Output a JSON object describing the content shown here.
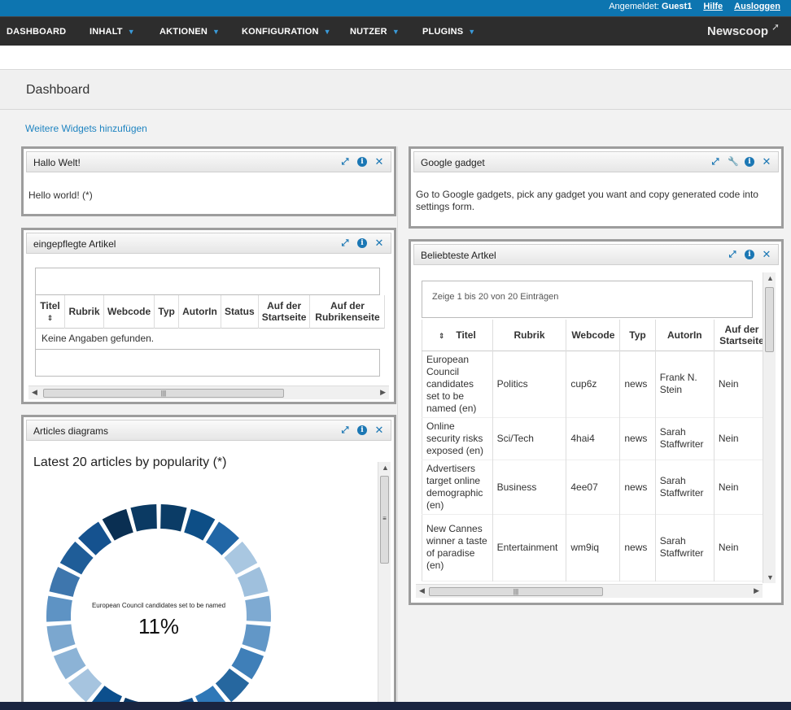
{
  "topbar": {
    "logged_in_label": "Angemeldet:",
    "user": "Guest1",
    "help": "Hilfe",
    "logout": "Ausloggen"
  },
  "nav": {
    "items": [
      "DASHBOARD",
      "INHALT",
      "AKTIONEN",
      "KONFIGURATION",
      "NUTZER",
      "PLUGINS"
    ],
    "logo": "Newscoop"
  },
  "page": {
    "title": "Dashboard",
    "add_widgets": "Weitere Widgets hinzufügen"
  },
  "hello_widget": {
    "title": "Hallo Welt!",
    "body": "Hello world! (*)"
  },
  "google_widget": {
    "title": "Google gadget",
    "body": "Go to Google gadgets, pick any gadget you want and copy generated code into settings form."
  },
  "maintained_widget": {
    "title": "eingepflegte Artikel",
    "headers": [
      "Titel",
      "Rubrik",
      "Webcode",
      "Typ",
      "AutorIn",
      "Status",
      "Auf der Startseite",
      "Auf der Rubrikenseite"
    ],
    "empty": "Keine Angaben gefunden."
  },
  "popular_widget": {
    "title": "Beliebteste Artkel",
    "info": "Zeige 1 bis 20 von 20 Einträgen",
    "headers": [
      "Titel",
      "Rubrik",
      "Webcode",
      "Typ",
      "AutorIn",
      "Auf der Startseite"
    ],
    "rows": [
      {
        "title": "European Council candidates set to be named (en)",
        "rubrik": "Politics",
        "webcode": "cup6z",
        "typ": "news",
        "autor": "Frank N. Stein",
        "start": "Nein"
      },
      {
        "title": "Online security risks exposed (en)",
        "rubrik": "Sci/Tech",
        "webcode": "4hai4",
        "typ": "news",
        "autor": "Sarah Staffwriter",
        "start": "Nein"
      },
      {
        "title": "Advertisers target online demographic (en)",
        "rubrik": "Business",
        "webcode": "4ee07",
        "typ": "news",
        "autor": "Sarah Staffwriter",
        "start": "Nein"
      },
      {
        "title": "New Cannes winner a taste of paradise (en)",
        "rubrik": "Entertainment",
        "webcode": "wm9iq",
        "typ": "news",
        "autor": "Sarah Staffwriter",
        "start": "Nein"
      }
    ]
  },
  "diagram_widget": {
    "title": "Articles diagrams",
    "heading": "Latest 20 articles by popularity (*)",
    "center_label": "European Council candidates set to be named",
    "center_value": "11%"
  },
  "chart_data": {
    "type": "pie",
    "title": "Latest 20 articles by popularity (*)",
    "highlighted": {
      "label": "European Council candidates set to be named",
      "value": 11
    },
    "slice_colors": [
      "#0b3c66",
      "#0d4e86",
      "#2166a6",
      "#a9c7e1",
      "#9fc0dd",
      "#7eaad2",
      "#6297c7",
      "#3f7fb8",
      "#26679f",
      "#2f78b8",
      "#134f8a",
      "#0e4478",
      "#0a3a69",
      "#0c4f8d",
      "#a6c4df",
      "#8cb3d6",
      "#7ba7cf",
      "#5e93c4",
      "#3e76ad",
      "#1f5d98",
      "#15528f",
      "#0a2f52",
      "#0b3a63"
    ]
  },
  "icons": {
    "maximize": "maximize-icon",
    "info": "info-icon",
    "close": "close-icon",
    "settings": "wrench-icon"
  }
}
